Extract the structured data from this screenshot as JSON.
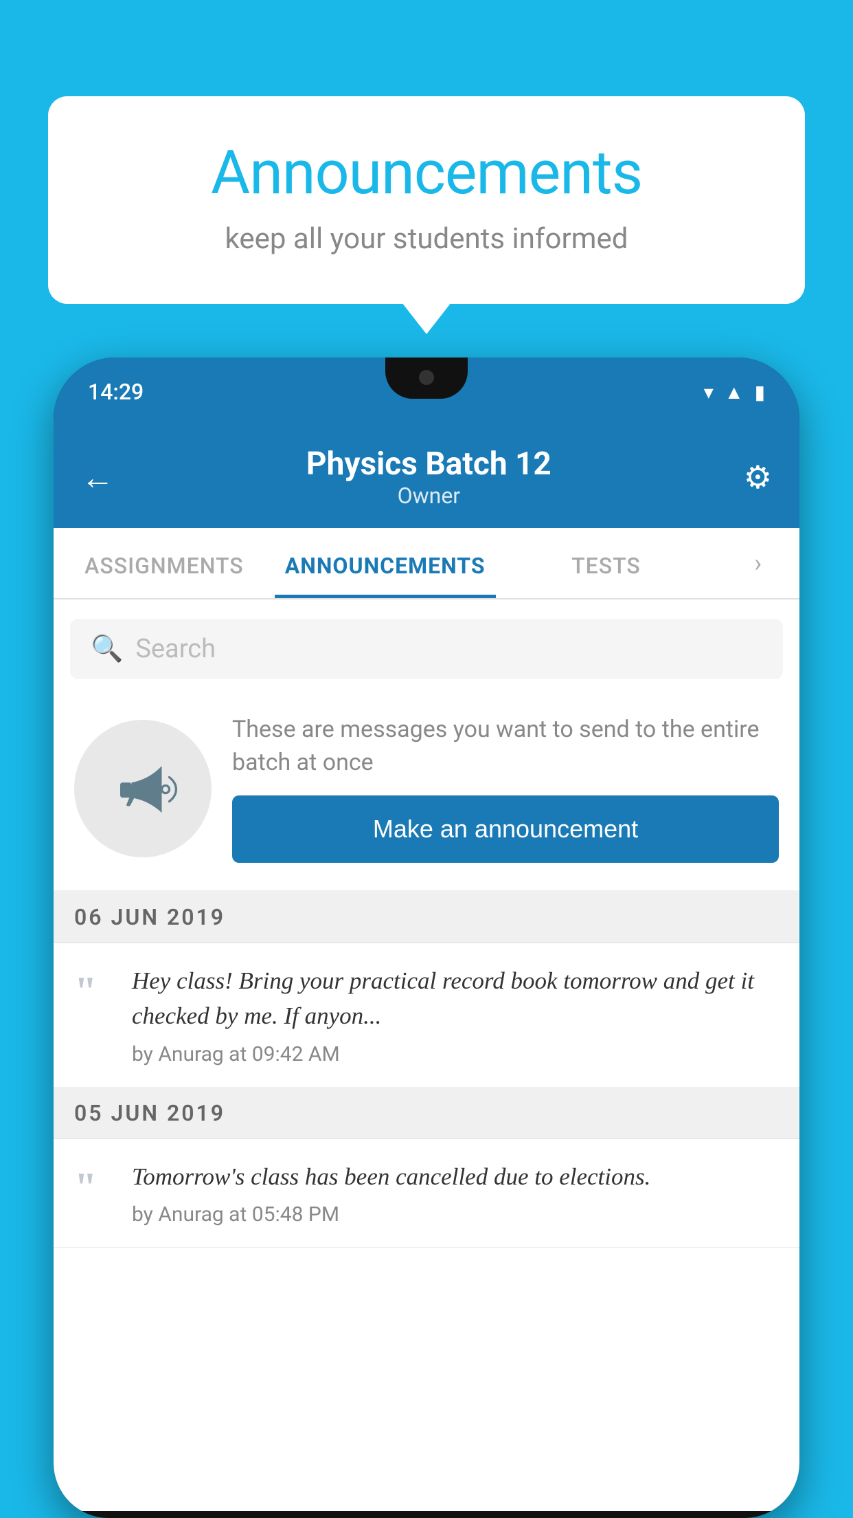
{
  "background_color": "#1ab8e8",
  "speech_bubble": {
    "title": "Announcements",
    "subtitle": "keep all your students informed"
  },
  "phone": {
    "status_bar": {
      "time": "14:29"
    },
    "header": {
      "title": "Physics Batch 12",
      "subtitle": "Owner",
      "back_label": "←",
      "gear_label": "⚙"
    },
    "tabs": [
      {
        "label": "ASSIGNMENTS",
        "active": false
      },
      {
        "label": "ANNOUNCEMENTS",
        "active": true
      },
      {
        "label": "TESTS",
        "active": false
      }
    ],
    "search": {
      "placeholder": "Search"
    },
    "empty_state": {
      "description": "These are messages you want to send to the entire batch at once",
      "button_label": "Make an announcement"
    },
    "announcements": [
      {
        "date": "06  JUN  2019",
        "text": "Hey class! Bring your practical record book tomorrow and get it checked by me. If anyon...",
        "meta": "by Anurag at 09:42 AM"
      },
      {
        "date": "05  JUN  2019",
        "text": "Tomorrow's class has been cancelled due to elections.",
        "meta": "by Anurag at 05:48 PM"
      }
    ]
  }
}
